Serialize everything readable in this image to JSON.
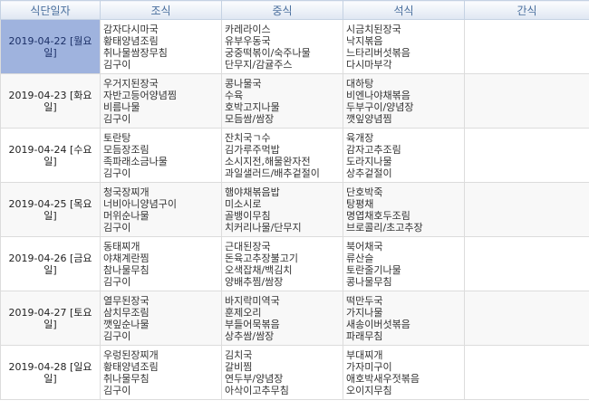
{
  "headers": [
    "식단일자",
    "조식",
    "중식",
    "석식",
    "간식"
  ],
  "rows": [
    {
      "date": "2019-04-22 [월요일]",
      "breakfast": [
        "감자다시마국",
        "황태양념조림",
        "취나물쌈장무침",
        "김구이"
      ],
      "lunch": [
        "카레라이스",
        "유부우동국",
        "궁중떡볶이/숙주나물",
        "단무지/감귤주스"
      ],
      "dinner": [
        "시금치된장국",
        "낙지볶음",
        "느타리버섯볶음",
        "다시마부각"
      ],
      "snack": []
    },
    {
      "date": "2019-04-23 [화요일]",
      "breakfast": [
        "우거지된장국",
        "자반고등어양념찜",
        "비름나물",
        "김구이"
      ],
      "lunch": [
        "콩나물국",
        "수육",
        "호박고지나물",
        "모듬쌈/쌈장"
      ],
      "dinner": [
        "대하탕",
        "비엔나야채볶음",
        "두부구이/양념장",
        "깻잎양념찜"
      ],
      "snack": []
    },
    {
      "date": "2019-04-24 [수요일]",
      "breakfast": [
        "토란탕",
        "모듬장조림",
        "족파래소금나물",
        "김구이"
      ],
      "lunch": [
        "잔치국ㄱ수",
        "김가루주먹밥",
        "소시지전,해물완자전",
        "과일샐러드/배추겉절이"
      ],
      "dinner": [
        "육개장",
        "감자고추조림",
        "도라지나물",
        "상추겉절이"
      ],
      "snack": []
    },
    {
      "date": "2019-04-25 [목요일]",
      "breakfast": [
        "청국장찌개",
        "너비아니양념구이",
        "머위순나물",
        "김구이"
      ],
      "lunch": [
        "햄야채볶음밥",
        "미소시로",
        "골뱅이무침",
        "치커리나물/단무지"
      ],
      "dinner": [
        "단호박죽",
        "탕평채",
        "명엽채호두조림",
        "브로콜리/초고추장"
      ],
      "snack": []
    },
    {
      "date": "2019-04-26 [금요일]",
      "breakfast": [
        "동태찌개",
        "야채계란찜",
        "참나물무침",
        "김구이"
      ],
      "lunch": [
        "근대된장국",
        "돈육고추장불고기",
        "오색잡채/백김치",
        "양배추찜/쌈장"
      ],
      "dinner": [
        "북어채국",
        "류산슬",
        "토란줄기나물",
        "콩나물무침"
      ],
      "snack": []
    },
    {
      "date": "2019-04-27 [토요일]",
      "breakfast": [
        "열무된장국",
        "삼치무조림",
        "깻잎순나물",
        "김구이"
      ],
      "lunch": [
        "바지락미역국",
        "훈제오리",
        "부들어묵볶음",
        "상추쌈/쌈장"
      ],
      "dinner": [
        "떡만두국",
        "가지나물",
        "새송이버섯볶음",
        "파래무침"
      ],
      "snack": []
    },
    {
      "date": "2019-04-28 [일요일]",
      "breakfast": [
        "우렁된장찌개",
        "황태양념조림",
        "취나물무침",
        "김구이"
      ],
      "lunch": [
        "김치국",
        "갈비찜",
        "연두부/양념장",
        "아삭이고추무침"
      ],
      "dinner": [
        "부대찌개",
        "가자미구이",
        "애호박새우젓볶음",
        "오이지무침"
      ],
      "snack": []
    }
  ]
}
